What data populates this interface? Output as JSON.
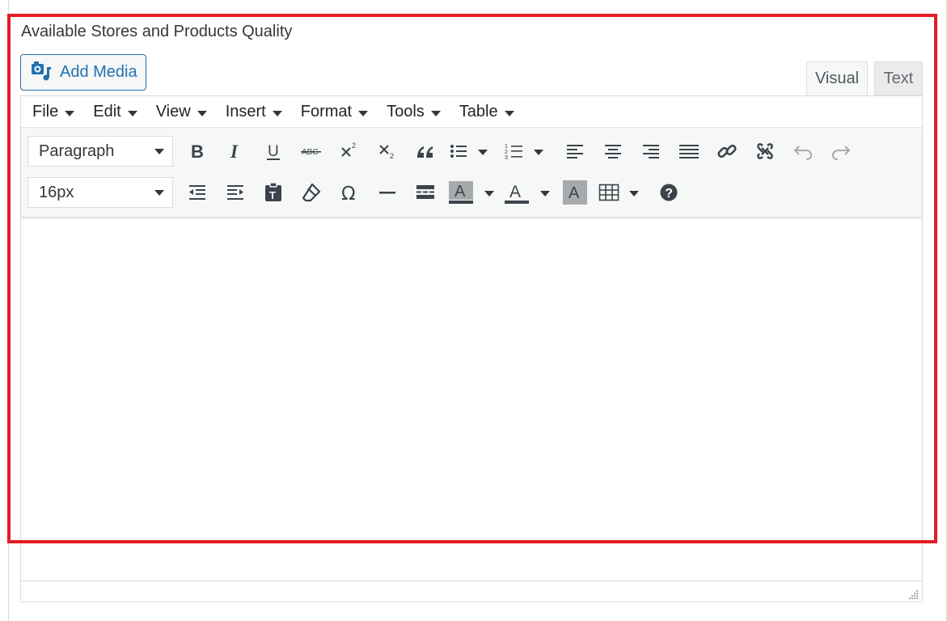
{
  "field": {
    "label": "Available Stores and Products Quality"
  },
  "media": {
    "add_label": "Add Media"
  },
  "tabs": {
    "visual": "Visual",
    "text": "Text"
  },
  "menubar": {
    "items": [
      "File",
      "Edit",
      "View",
      "Insert",
      "Format",
      "Tools",
      "Table"
    ]
  },
  "toolbar": {
    "block_format": "Paragraph",
    "font_size": "16px",
    "row1_buttons": [
      "bold-icon",
      "italic-icon",
      "underline-icon",
      "strikethrough-icon",
      "superscript-icon",
      "subscript-icon",
      "blockquote-icon",
      "bullet-list-icon",
      "numbered-list-icon",
      "align-left-icon",
      "align-center-icon",
      "align-right-icon",
      "align-justify-icon",
      "link-icon",
      "unlink-icon",
      "undo-icon",
      "redo-icon"
    ],
    "row2_buttons": [
      "outdent-icon",
      "indent-icon",
      "paste-as-text-icon",
      "clear-formatting-icon",
      "special-character-icon",
      "horizontal-line-icon",
      "read-more-icon",
      "background-color-icon",
      "text-color-icon",
      "highlight-icon",
      "table-icon",
      "help-icon"
    ],
    "glyphs": {
      "bold": "B",
      "italic": "I",
      "underline": "U",
      "strike": "ABC",
      "omega": "Ω",
      "letter_a": "A",
      "help": "?"
    }
  },
  "colors": {
    "accent": "#2271b1",
    "highlight_border": "#e31b23",
    "toolbar_bg": "#f6f7f7"
  }
}
